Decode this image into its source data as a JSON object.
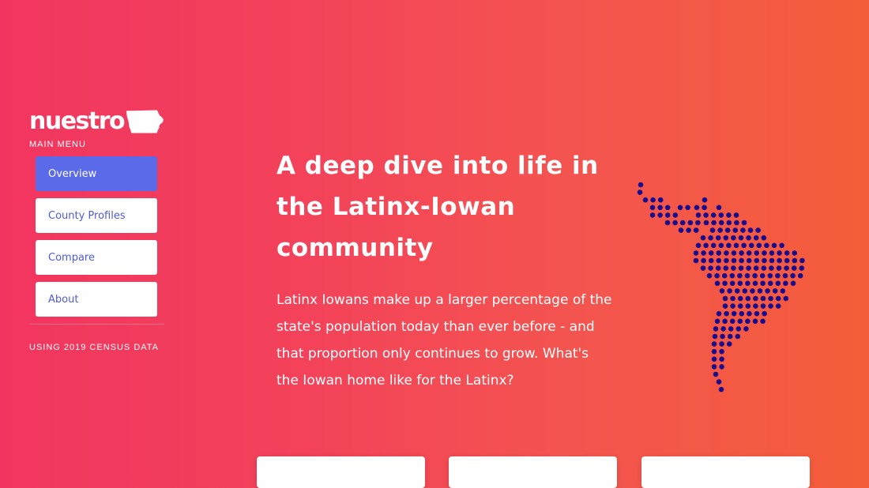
{
  "brand": {
    "name": "nuestro",
    "logo_icon": "iowa-state-icon"
  },
  "sidebar": {
    "heading": "MAIN MENU",
    "items": [
      {
        "label": "Overview",
        "active": true
      },
      {
        "label": "County Profiles",
        "active": false
      },
      {
        "label": "Compare",
        "active": false
      },
      {
        "label": "About",
        "active": false
      }
    ],
    "footnote": "USING 2019 CENSUS DATA"
  },
  "hero": {
    "headline": "A deep dive into life in the Latinx-Iowan community",
    "lede": "Latinx Iowans make up a larger percentage of the state's population today than ever before - and that proportion only continues to grow. What's the Iowan home like for the Latinx?",
    "map_icon": "latin-america-dot-map-icon"
  },
  "colors": {
    "gradient_start": "#f23560",
    "gradient_end": "#f55d3a",
    "active_button": "#5b6ae8",
    "button_text": "#4d5bd9",
    "map_dots": "#1a0b8c"
  }
}
